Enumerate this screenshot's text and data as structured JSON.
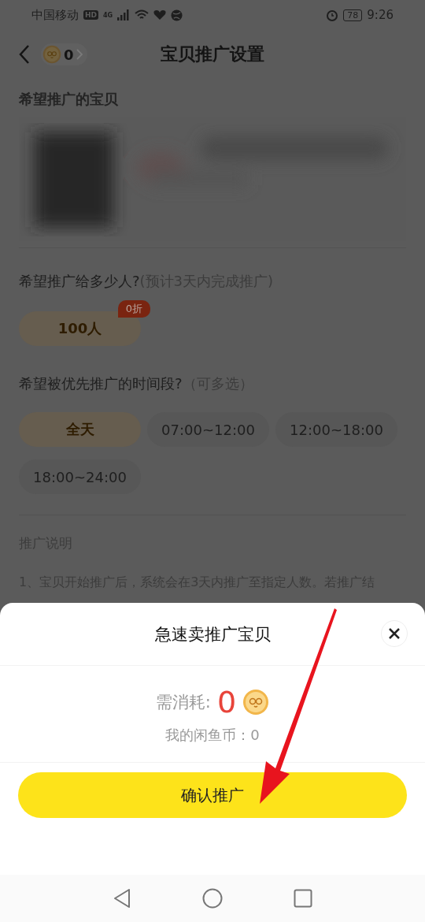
{
  "status_bar": {
    "carrier": "中国移动",
    "hd": "HD",
    "network": "4G",
    "battery": "78",
    "time": "9:26"
  },
  "header": {
    "coins": "0",
    "title": "宝贝推广设置"
  },
  "item_section": {
    "title": "希望推广的宝贝"
  },
  "audience": {
    "question": "希望推广给多少人?",
    "hint": "(预计3天内完成推广)",
    "options": [
      {
        "label": "100人",
        "badge": "0折",
        "selected": true
      }
    ]
  },
  "time_slots": {
    "question": "希望被优先推广的时间段?",
    "hint": "（可多选）",
    "options": [
      {
        "label": "全天",
        "selected": true
      },
      {
        "label": "07:00~12:00",
        "selected": false
      },
      {
        "label": "12:00~18:00",
        "selected": false
      },
      {
        "label": "18:00~24:00",
        "selected": false
      }
    ]
  },
  "notes": {
    "title": "推广说明",
    "lines": [
      "1、宝贝开始推广后，系统会在3天内推广至指定人数。若推广结"
    ]
  },
  "sheet": {
    "title": "急速卖推广宝贝",
    "cost_label": "需消耗:",
    "cost": "0",
    "balance": "我的闲鱼币：0",
    "confirm": "确认推广"
  }
}
